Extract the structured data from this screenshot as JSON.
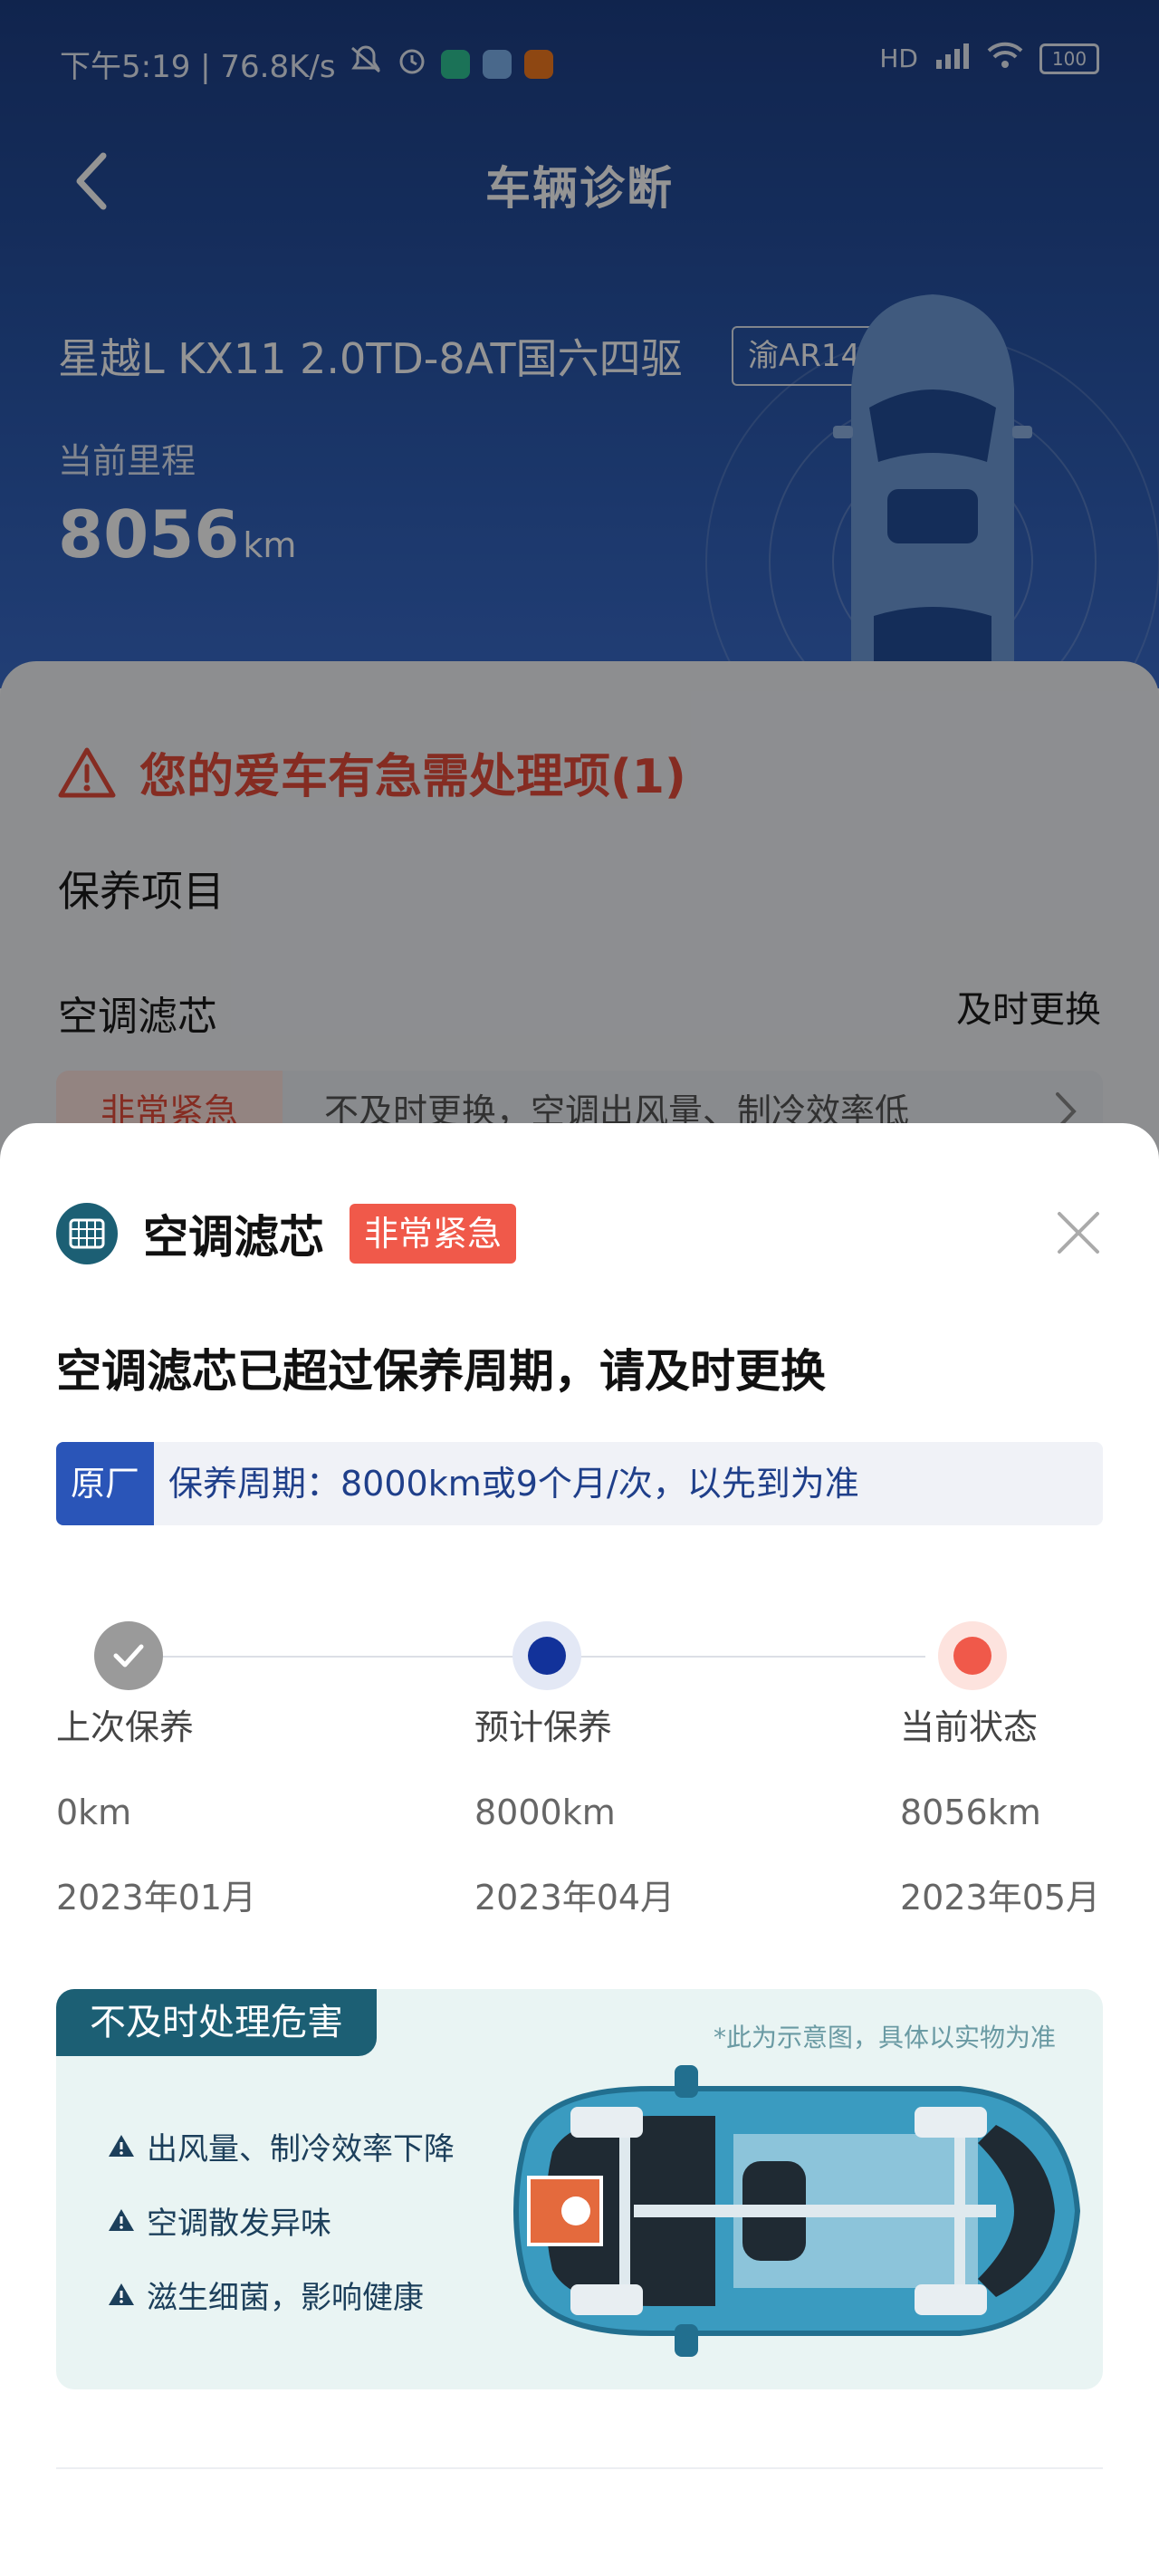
{
  "status_bar": {
    "left_text": "下午5:19 | 76.8K/s",
    "network": "HD",
    "battery": "100"
  },
  "nav": {
    "title": "车辆诊断"
  },
  "vehicle": {
    "model": "星越L   KX11 2.0TD-8AT国六四驱",
    "plate": "渝AR14C3",
    "mileage_label": "当前里程",
    "mileage_value": "8056",
    "mileage_unit": "km"
  },
  "background_card": {
    "alert": "您的爱车有急需处理项(1)",
    "section_title": "保养项目",
    "item_name": "空调滤芯",
    "item_action": "及时更换",
    "item_tag": "非常紧急",
    "item_desc": "不及时更换，空调出风量、制冷效率低"
  },
  "sheet": {
    "title": "空调滤芯",
    "badge": "非常紧急",
    "subtitle": "空调滤芯已超过保养周期，请及时更换",
    "cycle_tag": "原厂",
    "cycle_text": "保养周期：8000km或9个月/次，以先到为准",
    "timeline": [
      {
        "label": "上次保养",
        "km": "0km",
        "date": "2023年01月"
      },
      {
        "label": "预计保养",
        "km": "8000km",
        "date": "2023年04月"
      },
      {
        "label": "当前状态",
        "km": "8056km",
        "date": "2023年05月"
      }
    ],
    "hazard": {
      "title": "不及时处理危害",
      "note": "*此为示意图，具体以实物为准",
      "items": [
        "出风量、制冷效率下降",
        "空调散发异味",
        "滋生细菌，影响健康"
      ]
    }
  },
  "colors": {
    "header_blue": "#2a58ad",
    "alert_red": "#e64c3c",
    "badge_red": "#f0594a",
    "teal": "#1c5f74",
    "oem_blue": "#2a55b8"
  }
}
